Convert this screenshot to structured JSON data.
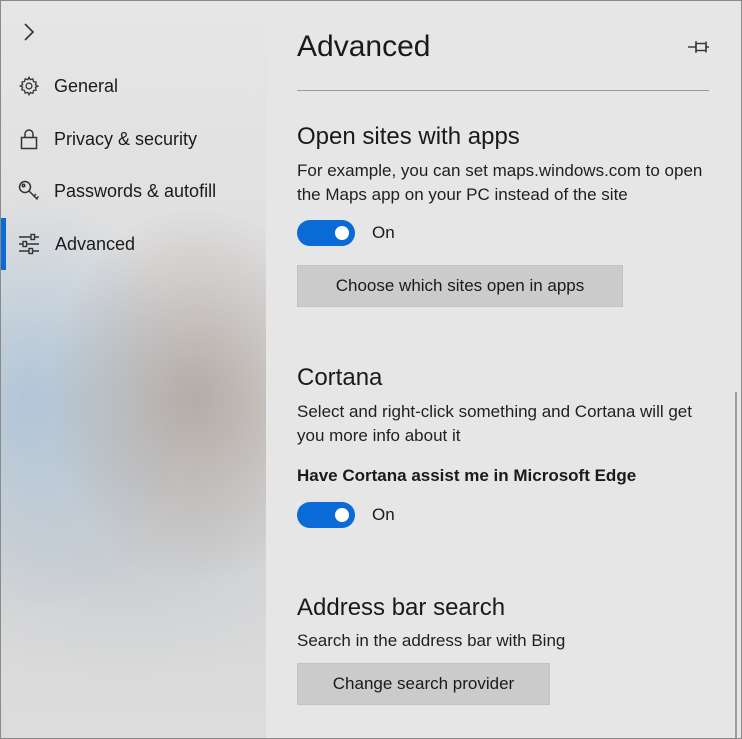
{
  "sidebar": {
    "collapse_icon": "chevron-right-icon",
    "items": [
      {
        "label": "General",
        "icon": "gear-icon",
        "active": false
      },
      {
        "label": "Privacy & security",
        "icon": "lock-icon",
        "active": false
      },
      {
        "label": "Passwords & autofill",
        "icon": "key-icon",
        "active": false
      },
      {
        "label": "Advanced",
        "icon": "sliders-icon",
        "active": true
      }
    ]
  },
  "main": {
    "title": "Advanced",
    "pin_icon": "pin-icon",
    "sections": {
      "open_sites": {
        "title": "Open sites with apps",
        "description": "For example, you can set maps.windows.com to open the Maps app on your PC instead of the site",
        "toggle_state": "On",
        "button_label": "Choose which sites open in apps"
      },
      "cortana": {
        "title": "Cortana",
        "description": "Select and right-click something and Cortana will get you more info about it",
        "setting_label": "Have Cortana assist me in Microsoft Edge",
        "toggle_state": "On"
      },
      "address_bar": {
        "title": "Address bar search",
        "description": "Search in the address bar with Bing",
        "button_label": "Change search provider"
      }
    }
  },
  "colors": {
    "accent": "#0a6ad6",
    "button_bg": "#cbcbcb",
    "panel_bg": "#e6e6e6"
  }
}
